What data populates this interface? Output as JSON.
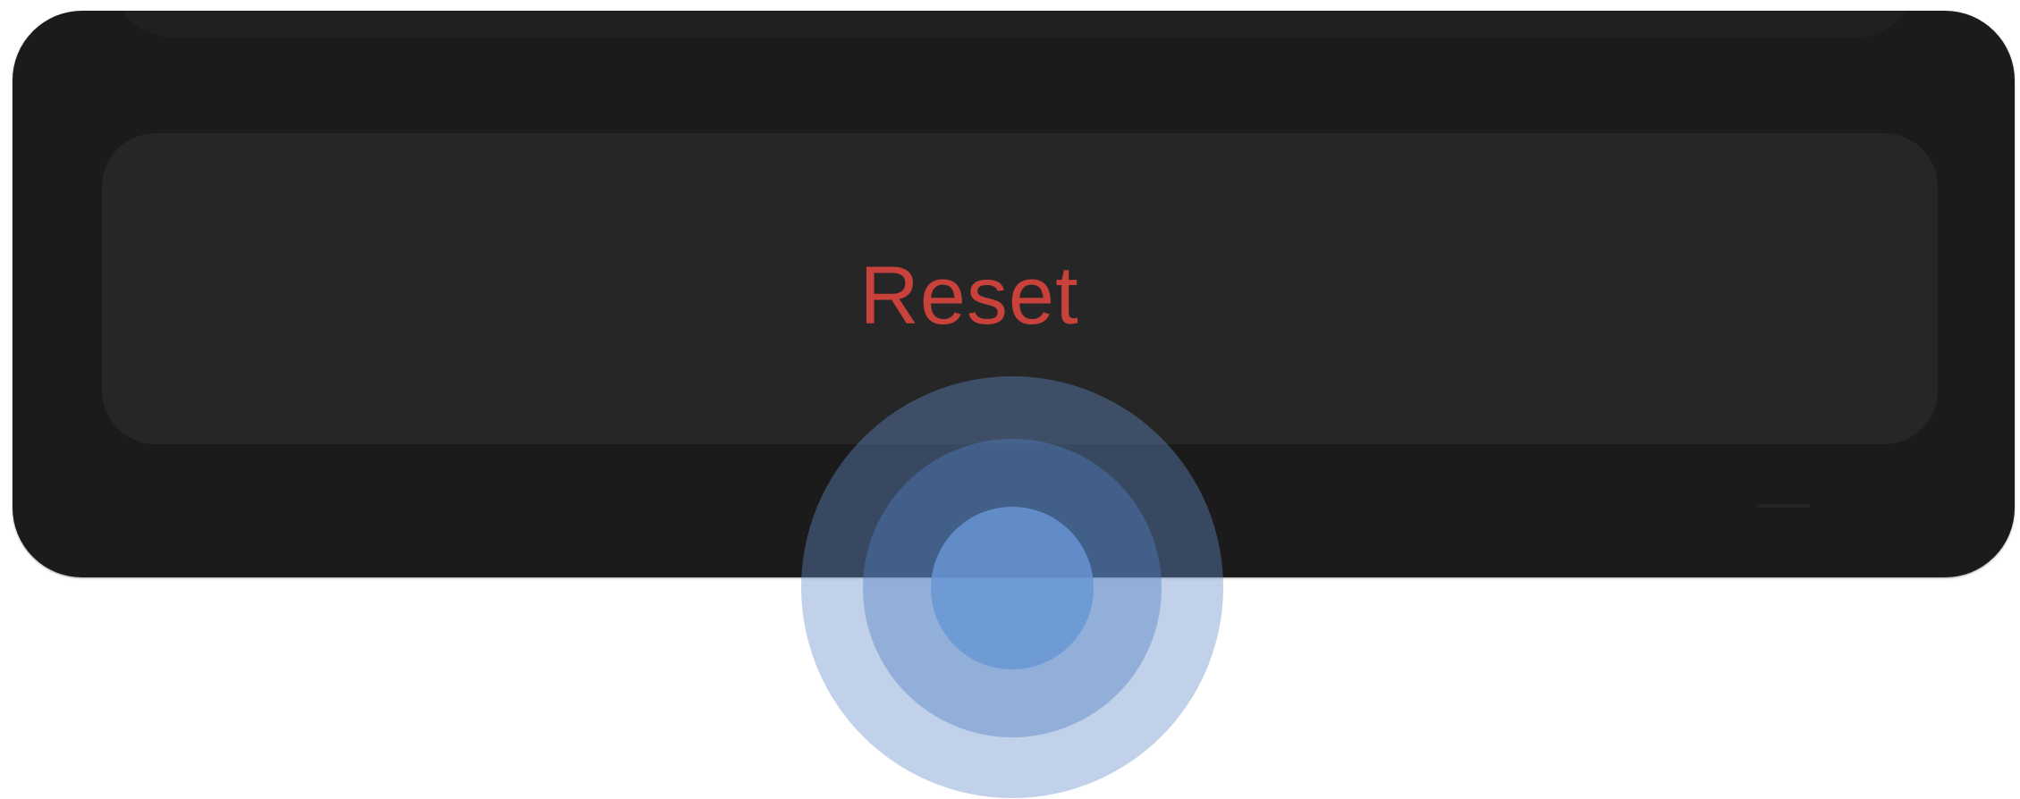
{
  "sheet": {
    "reset_label": "Reset",
    "reset_color": "#c8413a",
    "background_color": "#1b1b1b",
    "button_color": "#262626"
  },
  "touch_indicator": {
    "color": "#5b8ed0"
  }
}
